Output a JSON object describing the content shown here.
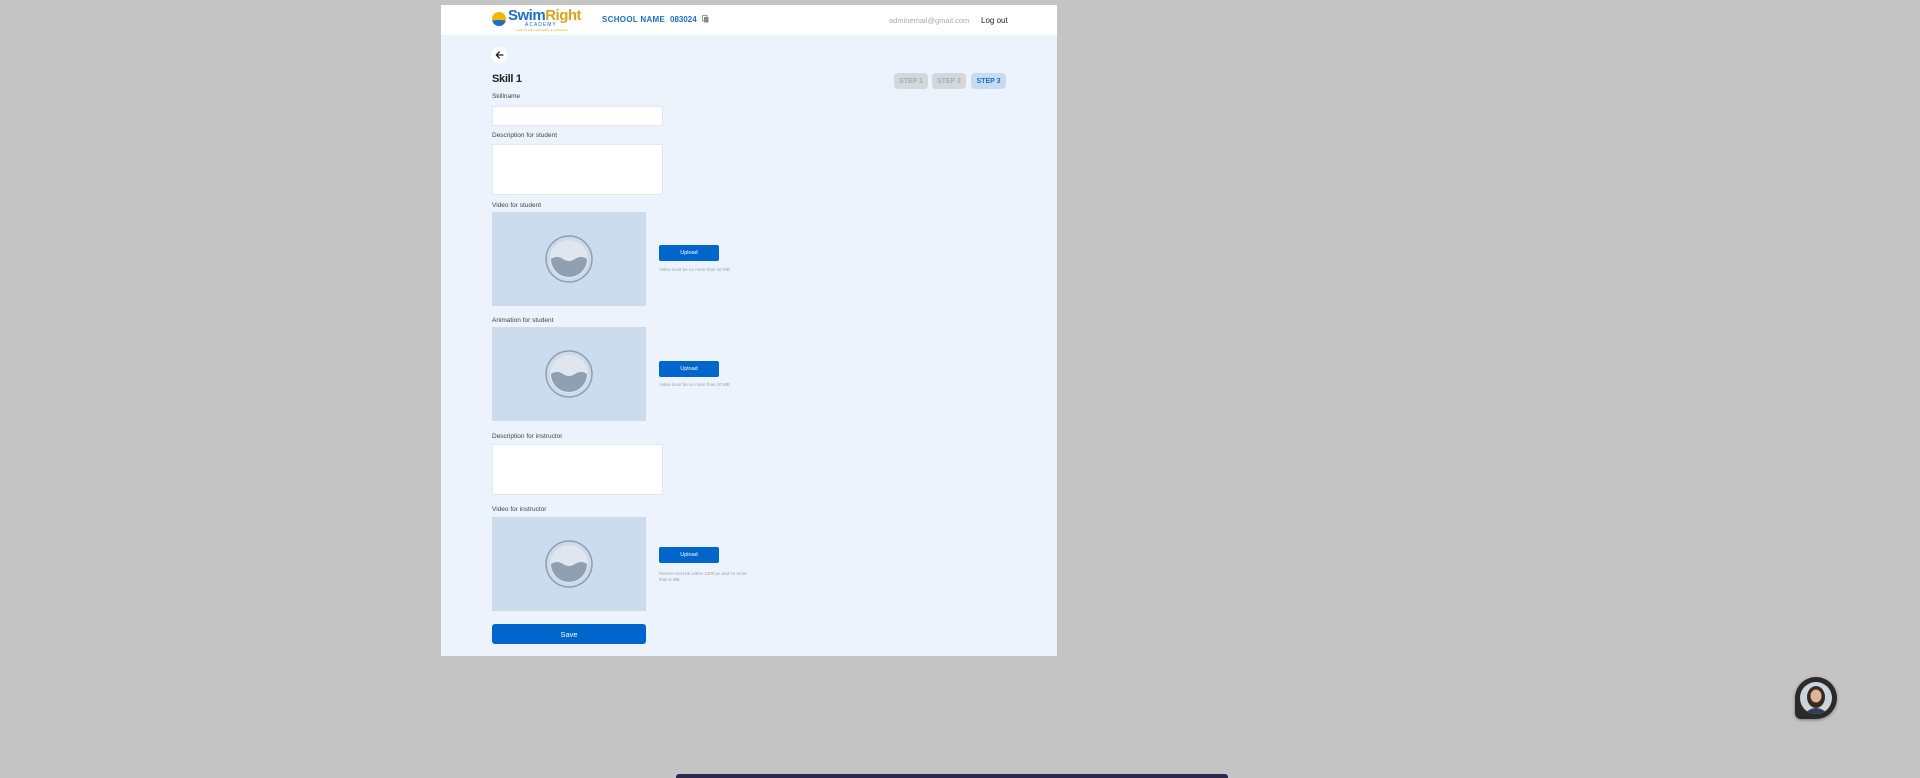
{
  "header": {
    "logo": {
      "brand_part1": "Swim",
      "brand_part2": "Right",
      "subtitle": "ACADEMY",
      "tagline": "Learn to swim with safety & confidence"
    },
    "school_name": "SCHOOL NAME",
    "school_code": "083024",
    "email": "adminemail@gmail.com",
    "logout_label": "Log out"
  },
  "page": {
    "title": "Skill 1",
    "steps": [
      {
        "label": "STEP 1",
        "state": "inactive"
      },
      {
        "label": "STEP 2",
        "state": "inactive"
      },
      {
        "label": "STEP 3",
        "state": "active"
      }
    ]
  },
  "form": {
    "skill_name": {
      "label": "Skillname",
      "value": ""
    },
    "description_student": {
      "label": "Description for student",
      "value": ""
    },
    "video_student": {
      "label": "Video for student",
      "upload_label": "Upload",
      "hint": "Video must be no more than 10 MB"
    },
    "animation_student": {
      "label": "Animation for student",
      "upload_label": "Upload",
      "hint": "Video must be no more than 10 MB"
    },
    "description_instructor": {
      "label": "Description for instructor",
      "value": ""
    },
    "video_instructor": {
      "label": "Video for instructor",
      "upload_label": "Upload",
      "hint": "Picture must be within 1000 px and no more than 5 MB"
    },
    "save_label": "Save"
  },
  "colors": {
    "accent": "#0066cc",
    "page_background": "#ecf3fc",
    "outer_background": "#c4c4c4",
    "step_active_bg": "#c7dcf2",
    "step_inactive_bg": "#d4d8dd"
  },
  "icons": {
    "back": "arrow-left-icon",
    "copy": "copy-icon",
    "media_placeholder": "water-wave-icon",
    "chat": "chat-avatar-icon"
  }
}
